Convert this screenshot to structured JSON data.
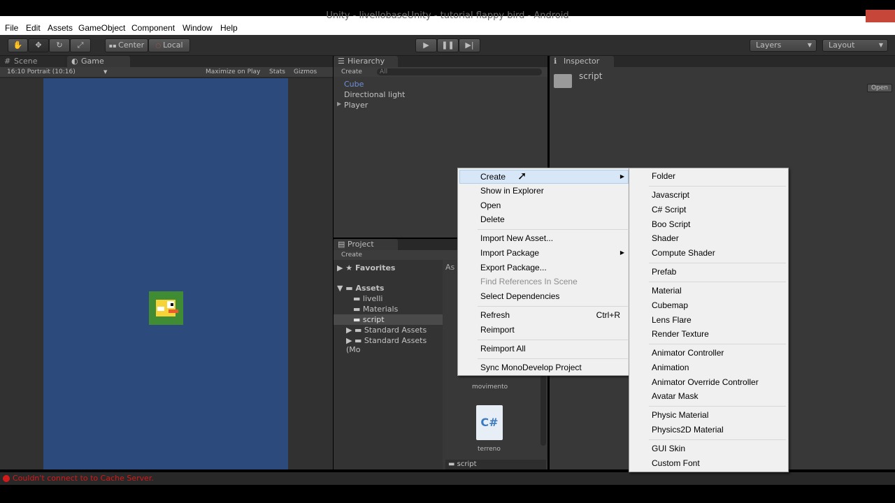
{
  "window": {
    "title": "Unity - livellobaseUnity - tutorial flappy bird - Android"
  },
  "menubar": [
    "File",
    "Edit",
    "Assets",
    "GameObject",
    "Component",
    "Window",
    "Help"
  ],
  "toolbar": {
    "pivot": "Center",
    "space": "Local",
    "layers": "Layers",
    "layout": "Layout"
  },
  "scene_panel": {
    "tabs": [
      "Scene",
      "Game"
    ],
    "aspect": "16:10 Portrait (10:16)",
    "maximize": "Maximize on Play",
    "stats": "Stats",
    "gizmos": "Gizmos"
  },
  "hierarchy": {
    "title": "Hierarchy",
    "create": "Create",
    "search_placeholder": "All",
    "items": [
      "Cube",
      "Directional light",
      "Player"
    ]
  },
  "inspector": {
    "title": "Inspector",
    "object": "script",
    "open_button": "Open"
  },
  "project": {
    "title": "Project",
    "create": "Create",
    "favorites": "Favorites",
    "assets": "Assets",
    "folders": [
      "livelli",
      "Materials",
      "script",
      "Standard Assets",
      "Standard Assets (Mo"
    ],
    "crumb": "As",
    "files": [
      "movimento",
      "terreno"
    ],
    "bottom_path": "script"
  },
  "status": {
    "message": "Couldn't connect to to Cache Server."
  },
  "context_menu": {
    "items": [
      {
        "label": "Create",
        "submenu": true
      },
      {
        "label": "Show in Explorer"
      },
      {
        "label": "Open"
      },
      {
        "label": "Delete"
      },
      {
        "label": "Import New Asset..."
      },
      {
        "label": "Import Package",
        "submenu": true
      },
      {
        "label": "Export Package..."
      },
      {
        "label": "Find References In Scene",
        "disabled": true
      },
      {
        "label": "Select Dependencies"
      },
      {
        "label": "Refresh",
        "shortcut": "Ctrl+R"
      },
      {
        "label": "Reimport"
      },
      {
        "label": "Reimport All"
      },
      {
        "label": "Sync MonoDevelop Project"
      }
    ]
  },
  "create_submenu": {
    "items": [
      "Folder",
      "Javascript",
      "C# Script",
      "Boo Script",
      "Shader",
      "Compute Shader",
      "Prefab",
      "Material",
      "Cubemap",
      "Lens Flare",
      "Render Texture",
      "Animator Controller",
      "Animation",
      "Animator Override Controller",
      "Avatar Mask",
      "Physic Material",
      "Physics2D Material",
      "GUI Skin",
      "Custom Font"
    ]
  }
}
